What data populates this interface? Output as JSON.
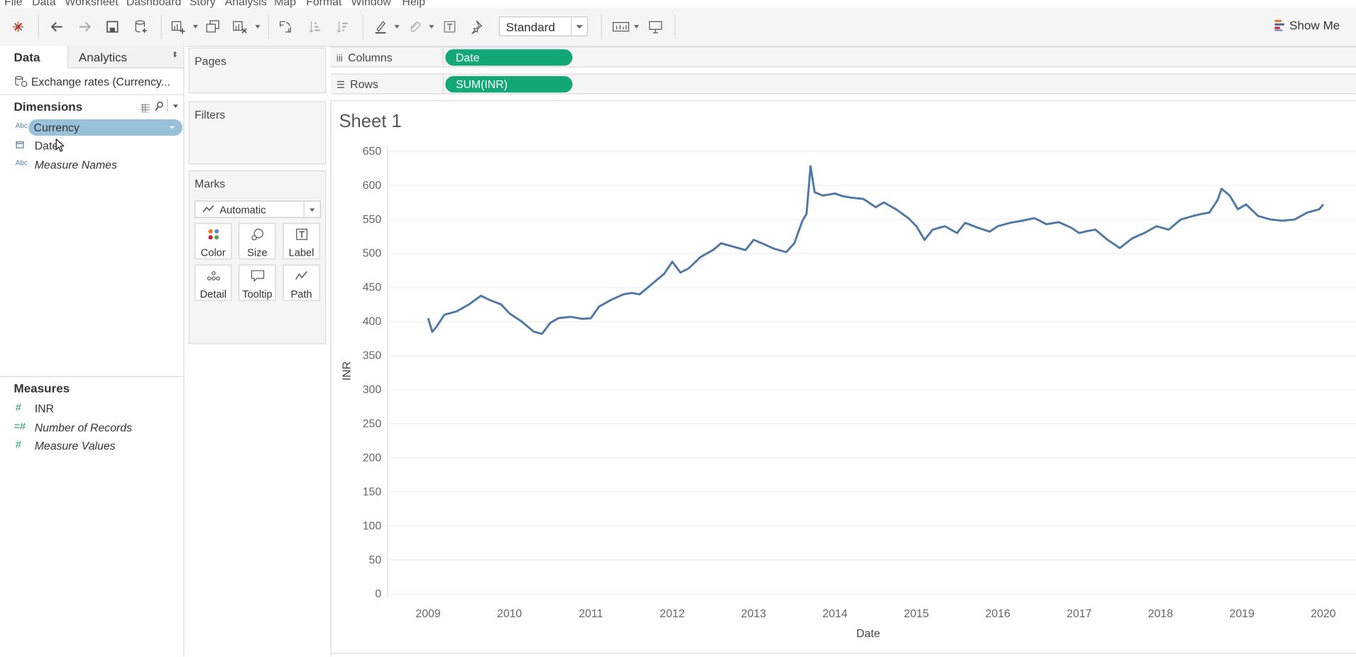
{
  "menu": [
    "File",
    "Data",
    "Worksheet",
    "Dashboard",
    "Story",
    "Analysis",
    "Map",
    "Format",
    "Window",
    "Help"
  ],
  "toolbar": {
    "fit_select": "Standard",
    "show_me": "Show Me"
  },
  "data_pane": {
    "tab_data": "Data",
    "tab_analytics": "Analytics",
    "data_source": "Exchange rates (Currency...",
    "dimensions_header": "Dimensions",
    "dimensions": [
      {
        "label": "Currency",
        "type": "Abc"
      },
      {
        "label": "Date",
        "type": "date"
      },
      {
        "label": "Measure Names",
        "type": "Abc"
      }
    ],
    "measures_header": "Measures",
    "measures": [
      {
        "label": "INR",
        "type": "#"
      },
      {
        "label": "Number of Records",
        "type": "=#"
      },
      {
        "label": "Measure Values",
        "type": "#"
      }
    ]
  },
  "cards": {
    "pages": "Pages",
    "filters": "Filters",
    "marks": "Marks",
    "mark_type": "Automatic",
    "buttons": [
      "Color",
      "Size",
      "Label",
      "Detail",
      "Tooltip",
      "Path"
    ]
  },
  "shelves": {
    "columns_label": "Columns",
    "columns_pill": "Date",
    "rows_label": "Rows",
    "rows_pill": "SUM(INR)"
  },
  "sheet": {
    "title": "Sheet 1"
  },
  "colors": {
    "line": "#4e79a7",
    "pill_green": "#13a676",
    "selected_field": "#98c0d9"
  },
  "chart_data": {
    "type": "line",
    "title": "",
    "xlabel": "Date",
    "ylabel": "INR",
    "ylim": [
      0,
      650
    ],
    "xlim": [
      2008.5,
      2020.2
    ],
    "y_ticks": [
      0,
      50,
      100,
      150,
      200,
      250,
      300,
      350,
      400,
      450,
      500,
      550,
      600,
      650
    ],
    "x_ticks": [
      "2009",
      "2010",
      "2011",
      "2012",
      "2013",
      "2014",
      "2015",
      "2016",
      "2017",
      "2018",
      "2019",
      "2020"
    ],
    "grid": true,
    "series": [
      {
        "x": [
          2009.0,
          2009.05,
          2009.1,
          2009.2,
          2009.35,
          2009.5,
          2009.65,
          2009.75,
          2009.9,
          2010.0,
          2010.15,
          2010.3,
          2010.4,
          2010.5,
          2010.6,
          2010.75,
          2010.9,
          2011.0,
          2011.1,
          2011.25,
          2011.4,
          2011.5,
          2011.6,
          2011.75,
          2011.9,
          2012.0,
          2012.1,
          2012.2,
          2012.35,
          2012.5,
          2012.6,
          2012.75,
          2012.9,
          2013.0,
          2013.1,
          2013.25,
          2013.4,
          2013.5,
          2013.6,
          2013.65,
          2013.7,
          2013.75,
          2013.85,
          2014.0,
          2014.1,
          2014.2,
          2014.35,
          2014.5,
          2014.6,
          2014.75,
          2014.9,
          2015.0,
          2015.1,
          2015.2,
          2015.35,
          2015.5,
          2015.6,
          2015.75,
          2015.9,
          2016.0,
          2016.15,
          2016.3,
          2016.45,
          2016.6,
          2016.75,
          2016.9,
          2017.0,
          2017.1,
          2017.2,
          2017.35,
          2017.5,
          2017.65,
          2017.8,
          2017.95,
          2018.1,
          2018.25,
          2018.4,
          2018.5,
          2018.6,
          2018.7,
          2018.75,
          2018.85,
          2018.95,
          2019.05,
          2019.2,
          2019.35,
          2019.5,
          2019.65,
          2019.8,
          2019.95,
          2020.0
        ],
        "y": [
          405,
          385,
          392,
          410,
          415,
          425,
          438,
          432,
          425,
          412,
          400,
          385,
          382,
          398,
          405,
          407,
          404,
          405,
          422,
          432,
          440,
          442,
          440,
          455,
          470,
          488,
          472,
          478,
          495,
          505,
          515,
          510,
          505,
          520,
          515,
          507,
          502,
          515,
          548,
          558,
          628,
          590,
          585,
          588,
          584,
          582,
          580,
          568,
          575,
          565,
          552,
          540,
          520,
          535,
          540,
          530,
          545,
          538,
          532,
          540,
          545,
          548,
          552,
          543,
          546,
          538,
          530,
          533,
          535,
          520,
          508,
          522,
          530,
          540,
          535,
          550,
          555,
          558,
          560,
          578,
          595,
          585,
          565,
          572,
          555,
          550,
          548,
          550,
          560,
          565,
          572
        ]
      }
    ]
  }
}
